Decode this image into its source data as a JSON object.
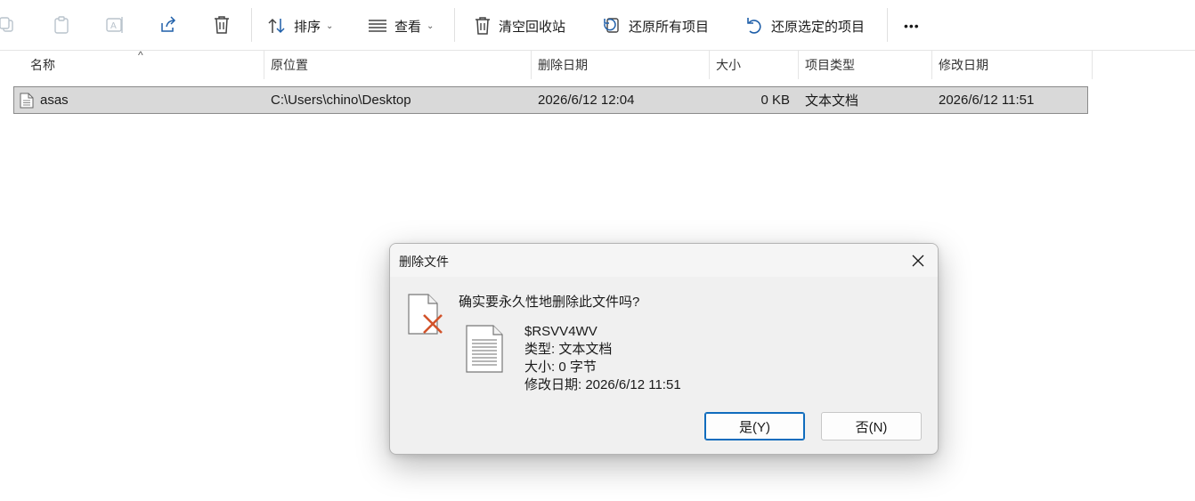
{
  "toolbar": {
    "copy_icon": "copy-icon",
    "paste_icon": "paste-icon",
    "rename_icon": "rename-icon",
    "share_icon": "share-icon",
    "delete_icon": "trash-icon",
    "sort_label": "排序",
    "view_label": "查看",
    "empty_bin_label": "清空回收站",
    "restore_all_label": "还原所有项目",
    "restore_selected_label": "还原选定的项目",
    "more_label": "•••"
  },
  "columns": {
    "name": "名称",
    "original_location": "原位置",
    "date_deleted": "删除日期",
    "size": "大小",
    "item_type": "项目类型",
    "date_modified": "修改日期"
  },
  "files": [
    {
      "name": "asas",
      "original_location": "C:\\Users\\chino\\Desktop",
      "date_deleted": "2026/6/12 12:04",
      "size": "0 KB",
      "item_type": "文本文档",
      "date_modified": "2026/6/12 11:51"
    }
  ],
  "dialog": {
    "title": "删除文件",
    "question": "确实要永久性地删除此文件吗?",
    "file_name": "$RSVV4WV",
    "type_line": "类型: 文本文档",
    "size_line": "大小: 0 字节",
    "modified_line": "修改日期: 2026/6/12 11:51",
    "yes_label": "是(Y)",
    "no_label": "否(N)"
  },
  "colors": {
    "accent": "#0f6cbd",
    "delete_cross": "#d2532b",
    "selection": "#d9d9d9"
  }
}
